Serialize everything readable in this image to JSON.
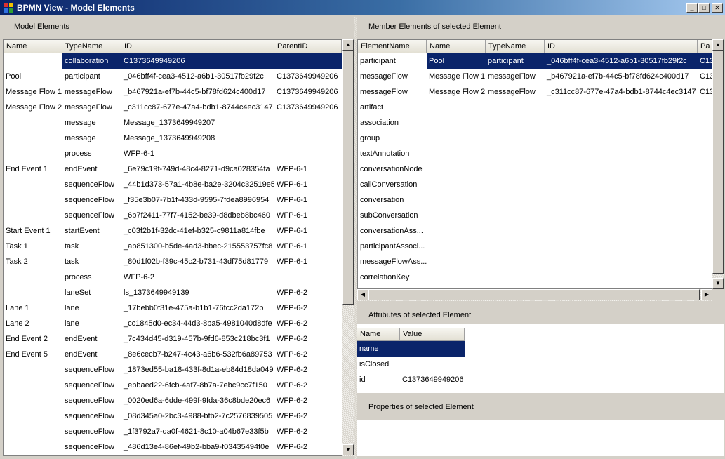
{
  "window": {
    "title": "BPMN View - Model Elements",
    "min_glyph": "_",
    "max_glyph": "□",
    "close_glyph": "✕"
  },
  "left": {
    "label": "Model Elements",
    "columns": [
      "Name",
      "TypeName",
      "ID",
      "ParentID"
    ],
    "rows": [
      [
        "",
        "collaboration",
        "C1373649949206",
        ""
      ],
      [
        "Pool",
        "participant",
        "_046bff4f-cea3-4512-a6b1-30517fb29f2c",
        "C1373649949206"
      ],
      [
        "Message Flow 1",
        "messageFlow",
        "_b467921a-ef7b-44c5-bf78fd624c400d17",
        "C1373649949206"
      ],
      [
        "Message Flow 2",
        "messageFlow",
        "_c311cc87-677e-47a4-bdb1-8744c4ec3147",
        "C1373649949206"
      ],
      [
        "",
        "message",
        "Message_1373649949207",
        ""
      ],
      [
        "",
        "message",
        "Message_1373649949208",
        ""
      ],
      [
        "",
        "process",
        "WFP-6-1",
        ""
      ],
      [
        "End Event 1",
        "endEvent",
        "_6e79c19f-749d-48c4-8271-d9ca028354fa",
        "WFP-6-1"
      ],
      [
        "",
        "sequenceFlow",
        "_44b1d373-57a1-4b8e-ba2e-3204c32519e5",
        "WFP-6-1"
      ],
      [
        "",
        "sequenceFlow",
        "_f35e3b07-7b1f-433d-9595-7fdea8996954",
        "WFP-6-1"
      ],
      [
        "",
        "sequenceFlow",
        "_6b7f2411-77f7-4152-be39-d8dbeb8bc460",
        "WFP-6-1"
      ],
      [
        "Start Event 1",
        "startEvent",
        "_c03f2b1f-32dc-41ef-b325-c9811a814fbe",
        "WFP-6-1"
      ],
      [
        "Task 1",
        "task",
        "_ab851300-b5de-4ad3-bbec-215553757fc8",
        "WFP-6-1"
      ],
      [
        "Task 2",
        "task",
        "_80d1f02b-f39c-45c2-b731-43df75d81779",
        "WFP-6-1"
      ],
      [
        "",
        "process",
        "WFP-6-2",
        ""
      ],
      [
        "",
        "laneSet",
        "ls_1373649949139",
        "WFP-6-2"
      ],
      [
        "Lane 1",
        "lane",
        "_17bebb0f31e-475a-b1b1-76fcc2da172b",
        "WFP-6-2"
      ],
      [
        "Lane 2",
        "lane",
        "_cc1845d0-ec34-44d3-8ba5-4981040d8dfe",
        "WFP-6-2"
      ],
      [
        "End Event 2",
        "endEvent",
        "_7c434d45-d319-457b-9fd6-853c218bc3f1",
        "WFP-6-2"
      ],
      [
        "End Event 5",
        "endEvent",
        "_8e6cecb7-b247-4c43-a6b6-532fb6a89753",
        "WFP-6-2"
      ],
      [
        "",
        "sequenceFlow",
        "_1873ed55-ba18-433f-8d1a-eb84d18da049",
        "WFP-6-2"
      ],
      [
        "",
        "sequenceFlow",
        "_ebbaed22-6fcb-4af7-8b7a-7ebc9cc7f150",
        "WFP-6-2"
      ],
      [
        "",
        "sequenceFlow",
        "_0020ed6a-6dde-499f-9fda-36c8bde20ec6",
        "WFP-6-2"
      ],
      [
        "",
        "sequenceFlow",
        "_08d345a0-2bc3-4988-bfb2-7c2576839505",
        "WFP-6-2"
      ],
      [
        "",
        "sequenceFlow",
        "_1f3792a7-da0f-4621-8c10-a04b67e33f5b",
        "WFP-6-2"
      ],
      [
        "",
        "sequenceFlow",
        "_486d13e4-86ef-49b2-bba9-f03435494f0e",
        "WFP-6-2"
      ]
    ]
  },
  "member": {
    "label": "Member Elements of selected Element",
    "columns": [
      "ElementName",
      "Name",
      "TypeName",
      "ID",
      "Pa"
    ],
    "rows": [
      [
        "participant",
        "Pool",
        "participant",
        "_046bff4f-cea3-4512-a6b1-30517fb29f2c",
        "C13"
      ],
      [
        "messageFlow",
        "Message Flow 1",
        "messageFlow",
        "_b467921a-ef7b-44c5-bf78fd624c400d17",
        "C13"
      ],
      [
        "messageFlow",
        "Message Flow 2",
        "messageFlow",
        "_c311cc87-677e-47a4-bdb1-8744c4ec3147",
        "C13"
      ],
      [
        "artifact",
        "",
        "",
        "",
        ""
      ],
      [
        "association",
        "",
        "",
        "",
        ""
      ],
      [
        "group",
        "",
        "",
        "",
        ""
      ],
      [
        "textAnnotation",
        "",
        "",
        "",
        ""
      ],
      [
        "conversationNode",
        "",
        "",
        "",
        ""
      ],
      [
        "callConversation",
        "",
        "",
        "",
        ""
      ],
      [
        "conversation",
        "",
        "",
        "",
        ""
      ],
      [
        "subConversation",
        "",
        "",
        "",
        ""
      ],
      [
        "conversationAss...",
        "",
        "",
        "",
        ""
      ],
      [
        "participantAssoci...",
        "",
        "",
        "",
        ""
      ],
      [
        "messageFlowAss...",
        "",
        "",
        "",
        ""
      ],
      [
        "correlationKey",
        "",
        "",
        "",
        ""
      ]
    ]
  },
  "attributes": {
    "label": "Attributes of selected Element",
    "columns": [
      "Name",
      "Value"
    ],
    "rows": [
      [
        "name",
        ""
      ],
      [
        "isClosed",
        ""
      ],
      [
        "id",
        "C1373649949206"
      ]
    ]
  },
  "properties": {
    "label": "Properties of selected Element"
  },
  "scroll_glyphs": {
    "up": "▲",
    "down": "▼",
    "left": "◀",
    "right": "▶"
  },
  "colors": {
    "selection": "#0a246a",
    "title_start": "#0a246a",
    "title_end": "#a6caf0"
  }
}
